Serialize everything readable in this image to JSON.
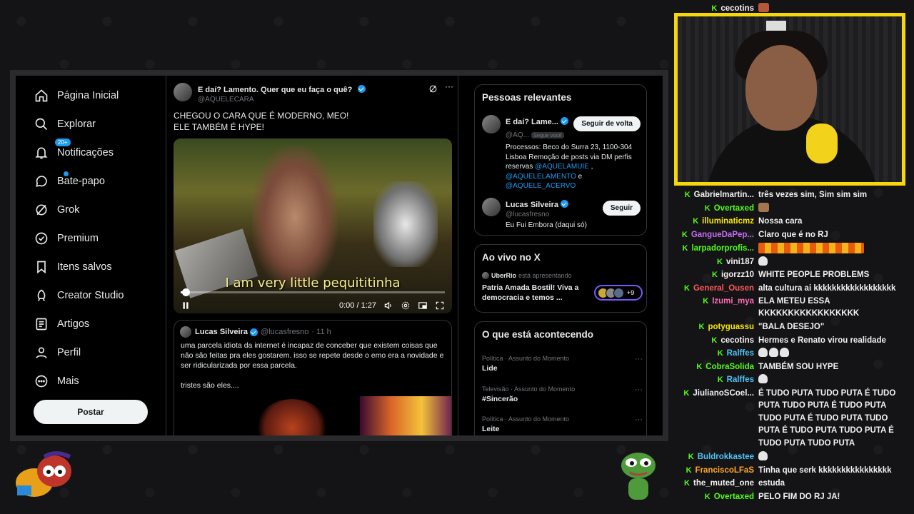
{
  "sidebar": {
    "items": [
      {
        "label": "Página Inicial",
        "icon": "home-icon"
      },
      {
        "label": "Explorar",
        "icon": "search-icon"
      },
      {
        "label": "Notificações",
        "icon": "bell-icon",
        "badge": "20+"
      },
      {
        "label": "Bate-papo",
        "icon": "chat-icon"
      },
      {
        "label": "Grok",
        "icon": "grok-icon"
      },
      {
        "label": "Premium",
        "icon": "premium-icon"
      },
      {
        "label": "Itens salvos",
        "icon": "bookmark-icon"
      },
      {
        "label": "Creator Studio",
        "icon": "rocket-icon"
      },
      {
        "label": "Artigos",
        "icon": "article-icon"
      },
      {
        "label": "Perfil",
        "icon": "person-icon"
      },
      {
        "label": "Mais",
        "icon": "more-circle-icon"
      }
    ],
    "post_button": "Postar"
  },
  "tweet": {
    "name": "E daí? Lamento. Quer que eu faça o quê?",
    "handle": "@AQUELECARA",
    "text_line1": "CHEGOU O CARA QUE É MODERNO, MEO!",
    "text_line2": "ELE TAMBÉM É HYPE!",
    "video": {
      "subtitle": "I am very little pequititinha",
      "time": "0:00 / 1:27",
      "progress": 0.02
    },
    "quote": {
      "name": "Lucas Silveira",
      "handle": "@lucasfresno",
      "time": "· 11 h",
      "text": "uma parcela idiota da internet é incapaz de conceber que existem coisas que não são feitas pra eles gostarem. isso se repete desde o emo era a novidade e ser ridicularizada por essa parcela.\n\ntristes são eles...."
    }
  },
  "relevant": {
    "title": "Pessoas relevantes",
    "people": [
      {
        "name": "E daí? Lame...",
        "handle": "@AQ...",
        "badge": "Segue você",
        "button": "Seguir de volta",
        "bio": "Processos: Beco do Surra 23, 1100-304 Lisboa Remoção de posts via DM perfis reservas",
        "bio_link1": "@AQUELAMUIE",
        "bio_sep": " ,",
        "bio_link2": "@AQUELELAMENTO",
        "bio_and": " e",
        "bio_link3": "@AQUELE_ACERVO"
      },
      {
        "name": "Lucas Silveira",
        "handle": "@lucasfresno",
        "button": "Seguir",
        "bio": "Eu Fui Embora (daqui só)"
      }
    ]
  },
  "live": {
    "title": "Ao vivo no X",
    "host": "UberRio",
    "host_suffix": "está apresentando",
    "stream_title": "Patria Amada Bostil! Viva a democracia e temos ...",
    "count": "+9"
  },
  "trends": {
    "title": "O que está acontecendo",
    "items": [
      {
        "category": "Política · Assunto do Momento",
        "name": "Lide"
      },
      {
        "category": "Televisão · Assunto do Momento",
        "name": "#Sincerão"
      },
      {
        "category": "Política · Assunto do Momento",
        "name": "Leite"
      }
    ]
  },
  "chat": {
    "messages": [
      {
        "user": "cecotins",
        "color": "#f2f2f2",
        "text": ""
      },
      {
        "user": "Gabrielmartin...",
        "color": "#f2f2f2",
        "text": "três vezes sim, Sim sim sim"
      },
      {
        "user": "Overtaxed",
        "color": "#53fc18",
        "text": ""
      },
      {
        "user": "illuminaticmz",
        "color": "#f6e60d",
        "text": "Nossa cara"
      },
      {
        "user": "GangueDaPep...",
        "color": "#c46cf5",
        "text": "Claro que é no RJ"
      },
      {
        "user": "larpadorprofis...",
        "color": "#53fc18",
        "text": ""
      },
      {
        "user": "vini187",
        "color": "#f2f2f2",
        "text": ""
      },
      {
        "user": "igorzz10",
        "color": "#f2f2f2",
        "text": "WHITE PEOPLE PROBLEMS"
      },
      {
        "user": "General_Ousen",
        "color": "#ff5a5a",
        "text": "alta cultura ai kkkkkkkkkkkkkkkkkk"
      },
      {
        "user": "Izumi_mya",
        "color": "#ff6bb5",
        "text": "ELA METEU ESSA KKKKKKKKKKKKKKKKK"
      },
      {
        "user": "potyguassu",
        "color": "#f6e60d",
        "text": "\"BALA DESEJO\""
      },
      {
        "user": "cecotins",
        "color": "#f2f2f2",
        "text": "Hermes e Renato virou realidade"
      },
      {
        "user": "Ralffes",
        "color": "#4fc3f7",
        "text": ""
      },
      {
        "user": "CobraSolida",
        "color": "#53fc18",
        "text": "TAMBÉM SOU HYPE"
      },
      {
        "user": "Ralffes",
        "color": "#4fc3f7",
        "text": ""
      },
      {
        "user": "JiulianoSCoel...",
        "color": "#f2f2f2",
        "text": "É TUDO PUTA TUDO PUTA É TUDO PUTA TUDO PUTA É TUDO PUTA TUDO PUTA É TUDO PUTA TUDO PUTA É TUDO PUTA TUDO PUTA É TUDO PUTA TUDO PUTA"
      },
      {
        "user": "Buldrokkastee",
        "color": "#4fc3f7",
        "text": ""
      },
      {
        "user": "FranciscoLFaS",
        "color": "#ffa726",
        "text": "Tinha que serk kkkkkkkkkkkkkkkk"
      },
      {
        "user": "the_muted_one",
        "color": "#f2f2f2",
        "text": "estuda"
      },
      {
        "user": "Overtaxed",
        "color": "#53fc18",
        "text": "PELO FIM DO RJ JA!"
      }
    ]
  },
  "colors": {
    "accent": "#1d9bf0",
    "kick_green": "#53fc18",
    "cam_border": "#f6d60d"
  }
}
